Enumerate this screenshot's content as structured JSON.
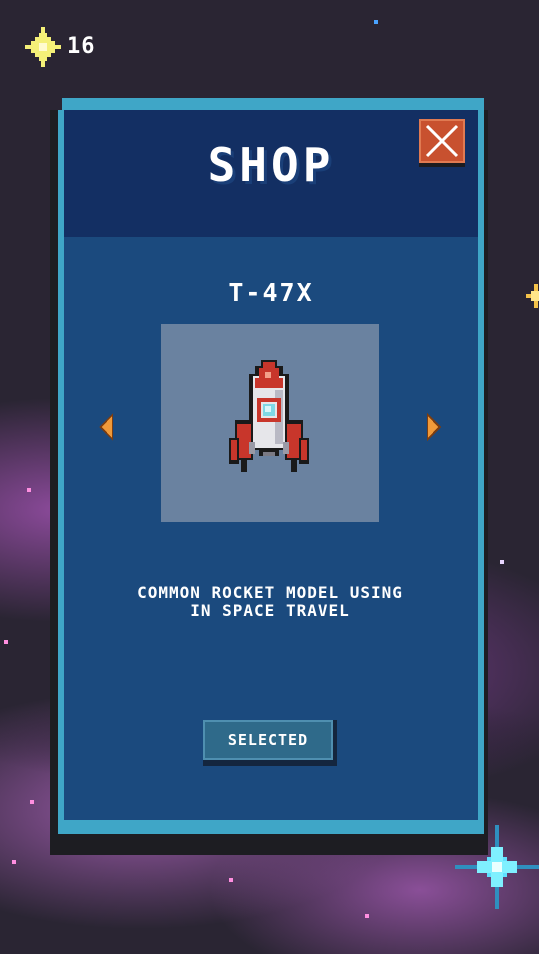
{
  "hud": {
    "coin_icon": "star-coin-icon",
    "coin_count": "16"
  },
  "shop": {
    "title": "SHOP",
    "close_icon": "close-x-icon",
    "ship_name": "T-47X",
    "description_lines": [
      "COMMON ROCKET MODEL USING",
      "IN SPACE TRAVEL"
    ],
    "select_label": "SELECTED",
    "prev_icon": "arrow-left-icon",
    "next_icon": "arrow-right-icon"
  },
  "colors": {
    "panel": "#1b4a7e",
    "panel_header": "#132f63",
    "panel_border": "#3fa6c7",
    "close_button": "#c8512f",
    "arrow": "#f09a3a",
    "coin": "#f4f078"
  }
}
